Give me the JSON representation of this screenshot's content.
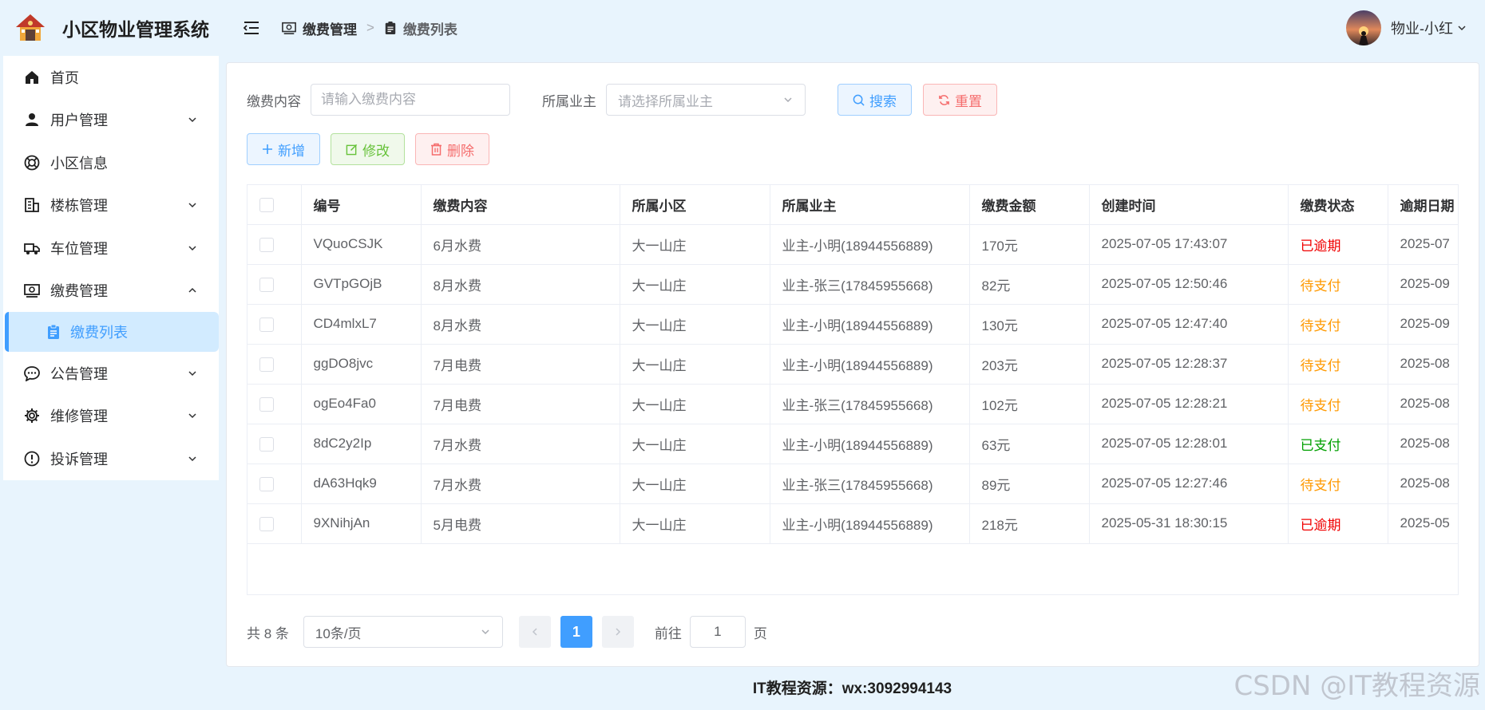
{
  "app": {
    "title": "小区物业管理系统"
  },
  "sidebar": {
    "items": [
      {
        "label": "首页",
        "icon": "home-icon",
        "has_children": false
      },
      {
        "label": "用户管理",
        "icon": "user-icon",
        "has_children": true
      },
      {
        "label": "小区信息",
        "icon": "lifebuoy-icon",
        "has_children": false
      },
      {
        "label": "楼栋管理",
        "icon": "building-icon",
        "has_children": true
      },
      {
        "label": "车位管理",
        "icon": "truck-icon",
        "has_children": true
      },
      {
        "label": "缴费管理",
        "icon": "wallet-icon",
        "has_children": true,
        "expanded": true
      },
      {
        "label": "公告管理",
        "icon": "chat-icon",
        "has_children": true
      },
      {
        "label": "维修管理",
        "icon": "gear-icon",
        "has_children": true
      },
      {
        "label": "投诉管理",
        "icon": "warning-icon",
        "has_children": true
      }
    ],
    "sub_item": {
      "label": "缴费列表",
      "icon": "clipboard-icon"
    }
  },
  "header": {
    "breadcrumb": [
      {
        "label": "缴费管理",
        "icon": "wallet-icon"
      },
      {
        "label": "缴费列表",
        "icon": "clipboard-icon"
      }
    ],
    "user_name": "物业-小红"
  },
  "search": {
    "content_label": "缴费内容",
    "content_placeholder": "请输入缴费内容",
    "owner_label": "所属业主",
    "owner_placeholder": "请选择所属业主",
    "search_label": "搜索",
    "reset_label": "重置"
  },
  "actions": {
    "add_label": "新增",
    "edit_label": "修改",
    "delete_label": "删除"
  },
  "table": {
    "columns": [
      "编号",
      "缴费内容",
      "所属小区",
      "所属业主",
      "缴费金额",
      "创建时间",
      "缴费状态",
      "逾期日期"
    ],
    "rows": [
      [
        "VQuoCSJK",
        "6月水费",
        "大一山庄",
        "业主-小明(18944556889)",
        "170元",
        "2025-07-05 17:43:07",
        "已逾期",
        "2025-07"
      ],
      [
        "GVTpGOjB",
        "8月水费",
        "大一山庄",
        "业主-张三(17845955668)",
        "82元",
        "2025-07-05 12:50:46",
        "待支付",
        "2025-09"
      ],
      [
        "CD4mlxL7",
        "8月水费",
        "大一山庄",
        "业主-小明(18944556889)",
        "130元",
        "2025-07-05 12:47:40",
        "待支付",
        "2025-09"
      ],
      [
        "ggDO8jvc",
        "7月电费",
        "大一山庄",
        "业主-小明(18944556889)",
        "203元",
        "2025-07-05 12:28:37",
        "待支付",
        "2025-08"
      ],
      [
        "ogEo4Fa0",
        "7月电费",
        "大一山庄",
        "业主-张三(17845955668)",
        "102元",
        "2025-07-05 12:28:21",
        "待支付",
        "2025-08"
      ],
      [
        "8dC2y2Ip",
        "7月水费",
        "大一山庄",
        "业主-小明(18944556889)",
        "63元",
        "2025-07-05 12:28:01",
        "已支付",
        "2025-08"
      ],
      [
        "dA63Hqk9",
        "7月水费",
        "大一山庄",
        "业主-张三(17845955668)",
        "89元",
        "2025-07-05 12:27:46",
        "待支付",
        "2025-08"
      ],
      [
        "9XNihjAn",
        "5月电费",
        "大一山庄",
        "业主-小明(18944556889)",
        "218元",
        "2025-05-31 18:30:15",
        "已逾期",
        "2025-05"
      ]
    ],
    "status_colors": {
      "已逾期": "#f00000",
      "待支付": "#ff9900",
      "已支付": "#00a000"
    }
  },
  "pagination": {
    "total_text": "共 8 条",
    "page_size": "10条/页",
    "current_page": "1",
    "goto_label": "前往",
    "goto_value": "1",
    "page_suffix": "页"
  },
  "footer": {
    "text": "IT教程资源：wx:3092994143"
  },
  "watermark": "CSDN @IT教程资源",
  "colors": {
    "accent": "#409eff",
    "background": "#e8f4fd"
  }
}
